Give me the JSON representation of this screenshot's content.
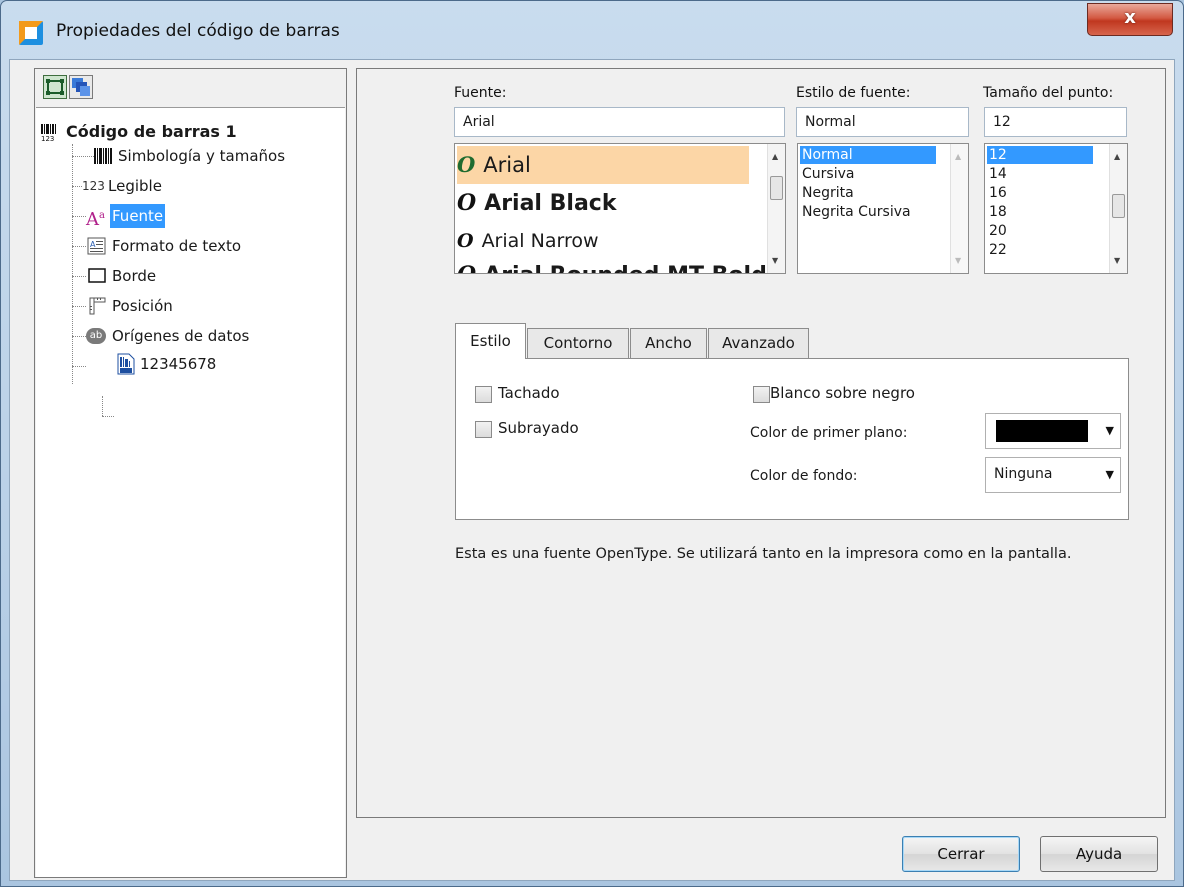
{
  "window": {
    "title": "Propiedades del código de barras",
    "close_label": "x"
  },
  "tree": {
    "root": "Código de barras 1",
    "items": [
      {
        "label": "Simbología y tamaños",
        "icon": "barcode-bars-icon"
      },
      {
        "label": "Legible",
        "icon": "digits-123-icon"
      },
      {
        "label": "Fuente",
        "icon": "font-a-icon",
        "selected": true
      },
      {
        "label": "Formato de texto",
        "icon": "text-format-icon"
      },
      {
        "label": "Borde",
        "icon": "border-icon"
      },
      {
        "label": "Posición",
        "icon": "position-ruler-icon"
      },
      {
        "label": "Orígenes de datos",
        "icon": "data-sources-icon"
      }
    ],
    "datasource": "12345678"
  },
  "font": {
    "font_label": "Fuente:",
    "font_value": "Arial",
    "fonts": [
      "Arial",
      "Arial Black",
      "Arial Narrow",
      "Arial Rounded MT Bold"
    ],
    "style_label": "Estilo de fuente:",
    "style_value": "Normal",
    "styles": [
      "Normal",
      "Cursiva",
      "Negrita",
      "Negrita Cursiva"
    ],
    "size_label": "Tamaño del punto:",
    "size_value": "12",
    "sizes": [
      "12",
      "14",
      "16",
      "18",
      "20",
      "22"
    ]
  },
  "tabs": [
    "Estilo",
    "Contorno",
    "Ancho",
    "Avanzado"
  ],
  "estilo": {
    "strike": "Tachado",
    "underline": "Subrayado",
    "white_on_black": "Blanco sobre negro",
    "fg_label": "Color de primer plano:",
    "fg_color": "#000000",
    "bg_label": "Color de fondo:",
    "bg_value": "Ninguna"
  },
  "info": "Esta es una fuente OpenType. Se utilizará tanto en la impresora como en la pantalla.",
  "buttons": {
    "close": "Cerrar",
    "help": "Ayuda"
  }
}
